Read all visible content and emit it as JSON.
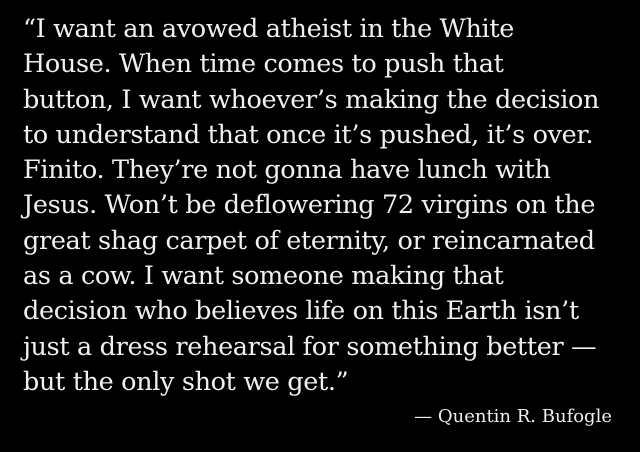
{
  "quote": {
    "lines": [
      "“I want an avowed atheist in the White",
      "House. When time comes to push that",
      "button, I want whoever’s making the decision",
      "to understand that once it’s pushed, it’s over.",
      "Finito. They’re not gonna have lunch with",
      "Jesus. Won’t be deflowering 72 virgins on the",
      "great shag carpet of eternity, or reincarnated",
      "as a cow. I want someone making that",
      "decision who believes life on this Earth isn’t",
      "just a dress rehearsal for something better —",
      "but the only shot we get.”"
    ],
    "attribution": "— Quentin R. Bufogle"
  },
  "colors": {
    "background": "#000000",
    "text": "#f0f0f0"
  }
}
